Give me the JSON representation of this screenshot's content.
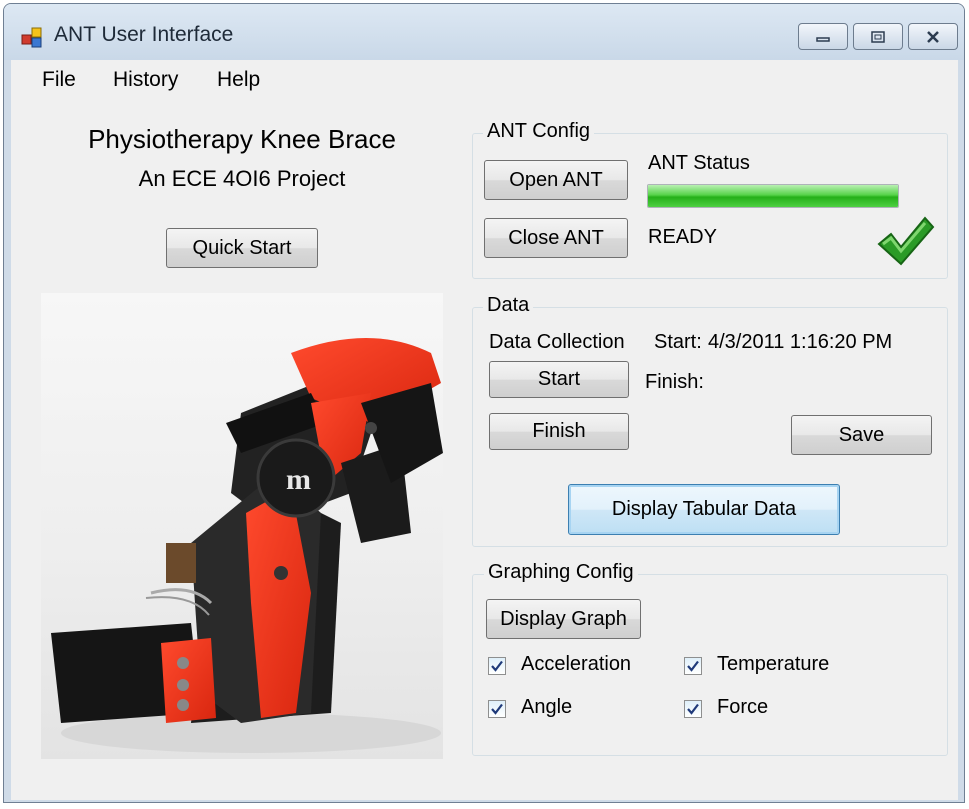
{
  "window": {
    "title": "ANT User Interface"
  },
  "menu": [
    "File",
    "History",
    "Help"
  ],
  "header": {
    "title": "Physiotherapy Knee Brace",
    "subtitle": "An ECE 4OI6 Project",
    "quick_start": "Quick Start"
  },
  "ant_config": {
    "title": "ANT Config",
    "open_label": "Open ANT",
    "close_label": "Close ANT",
    "status_label": "ANT Status",
    "status_value": "READY",
    "progress": 1.0
  },
  "data_panel": {
    "title": "Data",
    "collection_label": "Data Collection",
    "start_label": "Start",
    "finish_label": "Finish",
    "start_text": "Start:",
    "start_time": "4/3/2011 1:16:20 PM",
    "finish_text": "Finish:",
    "save_label": "Save",
    "display_table_label": "Display Tabular Data"
  },
  "graphing": {
    "title": "Graphing Config",
    "display_graph_label": "Display Graph",
    "options": [
      {
        "label": "Acceleration",
        "checked": true
      },
      {
        "label": "Temperature",
        "checked": true
      },
      {
        "label": "Angle",
        "checked": true
      },
      {
        "label": "Force",
        "checked": true
      }
    ]
  },
  "colors": {
    "accent_green": "#2fbf1f",
    "check_green": "#2b9b27"
  }
}
